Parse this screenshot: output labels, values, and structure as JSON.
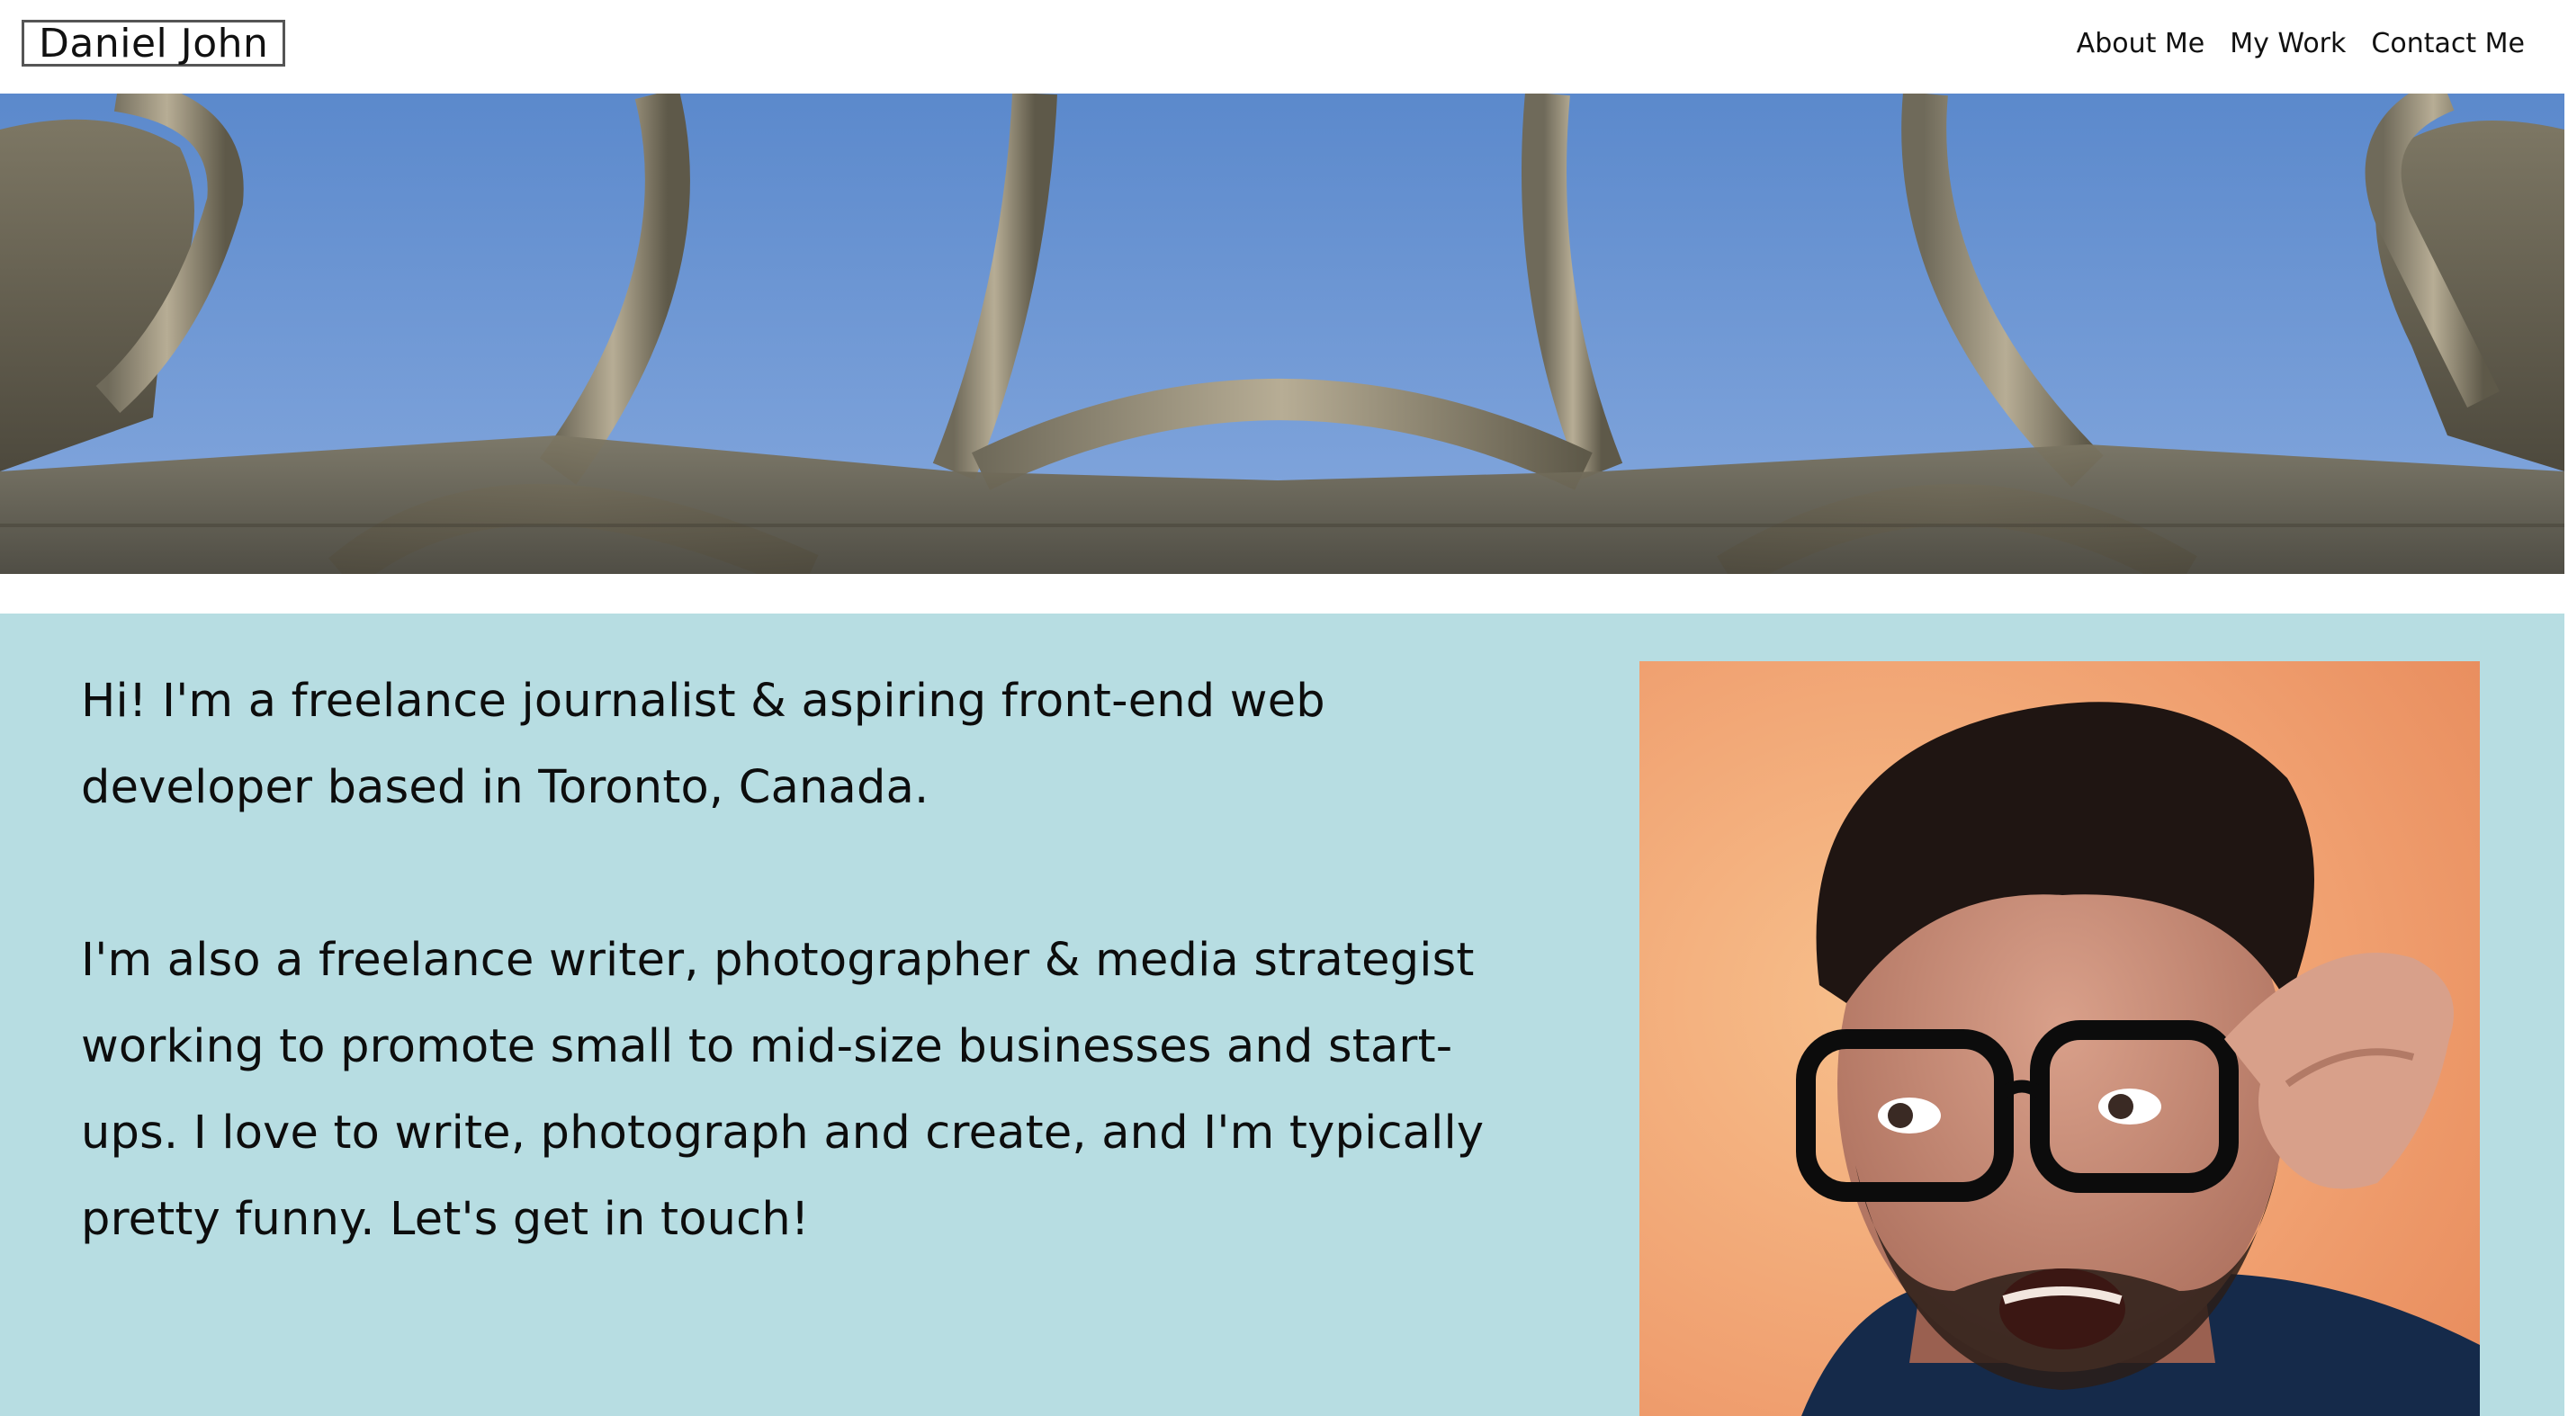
{
  "header": {
    "brand": "Daniel John",
    "nav": [
      {
        "label": "About Me"
      },
      {
        "label": "My Work"
      },
      {
        "label": "Contact Me"
      }
    ]
  },
  "hero": {
    "image": "ruined-gothic-arches-against-blue-sky",
    "colors": {
      "sky": "#6b96d3",
      "stone": "#9a927f"
    }
  },
  "intro": {
    "background": "#b7dde2",
    "paragraph_1": "Hi! I'm a freelance journalist & aspiring front-end web developer based in Toronto, Canada.",
    "paragraph_2": "I'm also a freelance writer, photographer & media strategist working to promote small to mid-size businesses and start-ups. I love to write, photograph and create, and I'm typically pretty funny. Let's get in touch!"
  },
  "portrait": {
    "image": "man-with-glasses-surprised-expression",
    "colors": {
      "background": "#f0a070"
    }
  }
}
